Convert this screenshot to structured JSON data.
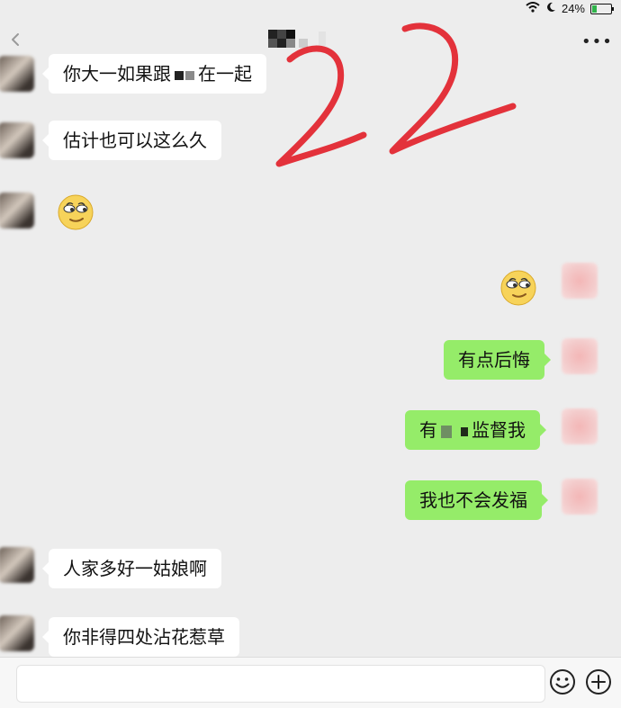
{
  "status_bar": {
    "battery_text": "24%",
    "battery_level": 0.24,
    "icons": [
      "wifi-icon",
      "moon-icon",
      "battery-charging-icon"
    ]
  },
  "title_bar": {
    "title_redacted": true,
    "back_icon": "chevron-left-icon",
    "more_icon": "more-dots-icon",
    "more_text": "•••"
  },
  "annotation": {
    "text": "22",
    "color": "#e3323b"
  },
  "messages": [
    {
      "side": "in",
      "type": "text",
      "parts": [
        "你大一如果跟",
        "在一起"
      ],
      "redacted": true
    },
    {
      "side": "in",
      "type": "text",
      "text": "估计也可以这么久"
    },
    {
      "side": "in",
      "type": "emoji",
      "emoji": "smirk-emoji"
    },
    {
      "side": "out",
      "type": "emoji",
      "emoji": "smirk-emoji"
    },
    {
      "side": "out",
      "type": "text",
      "text": "有点后悔"
    },
    {
      "side": "out",
      "type": "text",
      "parts": [
        "有",
        "监督我"
      ],
      "redacted": true
    },
    {
      "side": "out",
      "type": "text",
      "text": "我也不会发福"
    },
    {
      "side": "in",
      "type": "text",
      "text": "人家多好一姑娘啊"
    },
    {
      "side": "in",
      "type": "text",
      "text": "你非得四处沾花惹草"
    }
  ],
  "input_bar": {
    "placeholder": "",
    "emoji_icon": "emoji-icon",
    "plus_icon": "plus-icon",
    "voice_icon": "voice-icon"
  },
  "colors": {
    "background": "#ededed",
    "incoming_bubble": "#ffffff",
    "outgoing_bubble": "#95ec69",
    "annotation": "#e3323b"
  }
}
